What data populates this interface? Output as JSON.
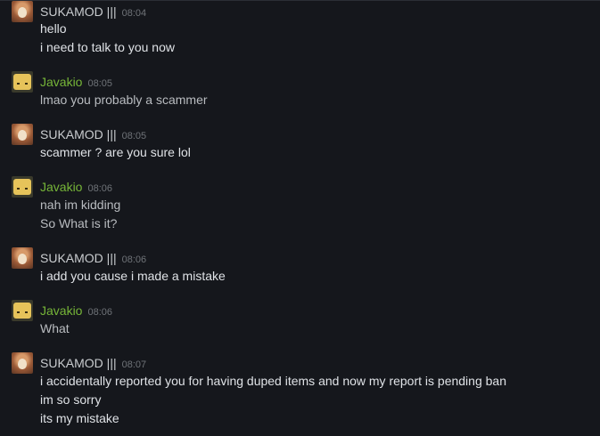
{
  "messages": [
    {
      "author": "SUKAMOD |||",
      "avatar": "sukamod-avatar",
      "time": "08:04",
      "lines": [
        "hello",
        "i need to talk to you now"
      ]
    },
    {
      "author": "Javakio",
      "avatar": "javakio-avatar",
      "time": "08:05",
      "lines": [
        "lmao you probably a scammer"
      ]
    },
    {
      "author": "SUKAMOD |||",
      "avatar": "sukamod-avatar",
      "time": "08:05",
      "lines": [
        "scammer ? are you sure lol"
      ]
    },
    {
      "author": "Javakio",
      "avatar": "javakio-avatar",
      "time": "08:06",
      "lines": [
        "nah im kidding",
        "So What is it?"
      ]
    },
    {
      "author": "SUKAMOD |||",
      "avatar": "sukamod-avatar",
      "time": "08:06",
      "lines": [
        "i add you cause i made a mistake"
      ]
    },
    {
      "author": "Javakio",
      "avatar": "javakio-avatar",
      "time": "08:06",
      "lines": [
        "What"
      ]
    },
    {
      "author": "SUKAMOD |||",
      "avatar": "sukamod-avatar",
      "time": "08:07",
      "lines": [
        "i accidentally reported you for having duped items and now my report is pending ban",
        "im so sorry",
        "its my mistake"
      ]
    }
  ],
  "colors": {
    "background": "#15171c",
    "friend_name": "#76b538",
    "self_name": "#c9cccf",
    "timestamp": "#6f7378"
  }
}
